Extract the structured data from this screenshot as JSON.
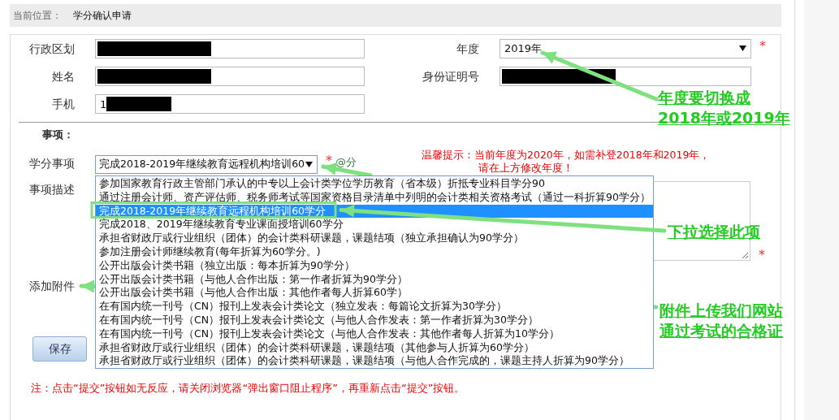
{
  "breadcrumb": {
    "label": "当前位置：",
    "value": "学分确认申请"
  },
  "rows": [
    {
      "left": {
        "label": "行政区划",
        "kind": "text",
        "redacted": true
      },
      "right": {
        "label": "年度",
        "kind": "select",
        "value": "2019年",
        "required": true,
        "required_mark": "*"
      }
    },
    {
      "left": {
        "label": "姓名",
        "kind": "text",
        "redacted": true
      },
      "right": {
        "label": "身份证明号",
        "kind": "text",
        "redacted": true
      }
    },
    {
      "left": {
        "label": "手机",
        "kind": "text",
        "value": "1",
        "redacted": true
      }
    }
  ],
  "section_title": "事项：",
  "credit_item": {
    "label": "学分事项",
    "value": "完成2018-2019年继续教育远程机构培训60",
    "required": true,
    "required_mark": "*",
    "suffix": "@分",
    "options": [
      {
        "label": "参加国家教育行政主管部门承认的中专以上会计类学位学历教育（省本级）折抵专业科目学分90",
        "selected": false
      },
      {
        "label": "通过注册会计师、资产评估师、税务师考试等国家资格目录清单中列明的会计类相关资格考试（通过一科折算90学分）",
        "selected": false
      },
      {
        "label": "完成2018-2019年继续教育远程机构培训60学分",
        "selected": true
      },
      {
        "label": "完成2018、2019年继续教育专业课面授培训60学分",
        "selected": false
      },
      {
        "label": "承担省财政厅或行业组织（团体）的会计类科研课题，课题结项（独立承担确认为90学分）",
        "selected": false
      },
      {
        "label": "参加注册会计师继续教育(每年折算为60学分。)",
        "selected": false
      },
      {
        "label": "公开出版会计类书籍（独立出版：每本折算为90学分）",
        "selected": false
      },
      {
        "label": "公开出版会计类书籍（与他人合作出版：第一作者折算为90学分）",
        "selected": false
      },
      {
        "label": "公开出版会计类书籍（与他人合作出版：其他作者每人折算60学）",
        "selected": false
      },
      {
        "label": "在有国内统一刊号（CN）报刊上发表会计类论文（独立发表：每篇论文折算为30学分）",
        "selected": false
      },
      {
        "label": "在有国内统一刊号（CN）报刊上发表会计类论文（与他人合作发表：第一作者折算为30学分）",
        "selected": false
      },
      {
        "label": "在有国内统一刊号（CN）报刊上发表会计类论文（与他人合作发表：其他作者每人折算为10学分）",
        "selected": false
      },
      {
        "label": "承担省财政厅或行业组织（团体）的会计类科研课题，课题结项（其他参与人折算为60学分）",
        "selected": false
      },
      {
        "label": "承担省财政厅或行业组织（团体）的会计类科研课题，课题结项（与他人合作完成的，课题主持人折算为90学分）",
        "selected": false
      }
    ]
  },
  "tip": [
    "温馨提示：当前年度为2020年，如需补登2018年和2019年，",
    "请在上方修改年度！"
  ],
  "description": {
    "label": "事项描述",
    "required": true,
    "required_mark": "*"
  },
  "attachment": {
    "label": "添加附件"
  },
  "save_button": "保存",
  "note": "注：点击“提交”按钮如无反应，请关闭浏览器“弹出窗口阻止程序”，再重新点击“提交”按钮。",
  "callouts": [
    {
      "lines": [
        "年度要切换成",
        "2018年或2019年"
      ]
    },
    {
      "lines": [
        "下拉选择此项"
      ]
    },
    {
      "lines": [
        "附件上传我们网站",
        "通过考试的合格证"
      ]
    }
  ]
}
